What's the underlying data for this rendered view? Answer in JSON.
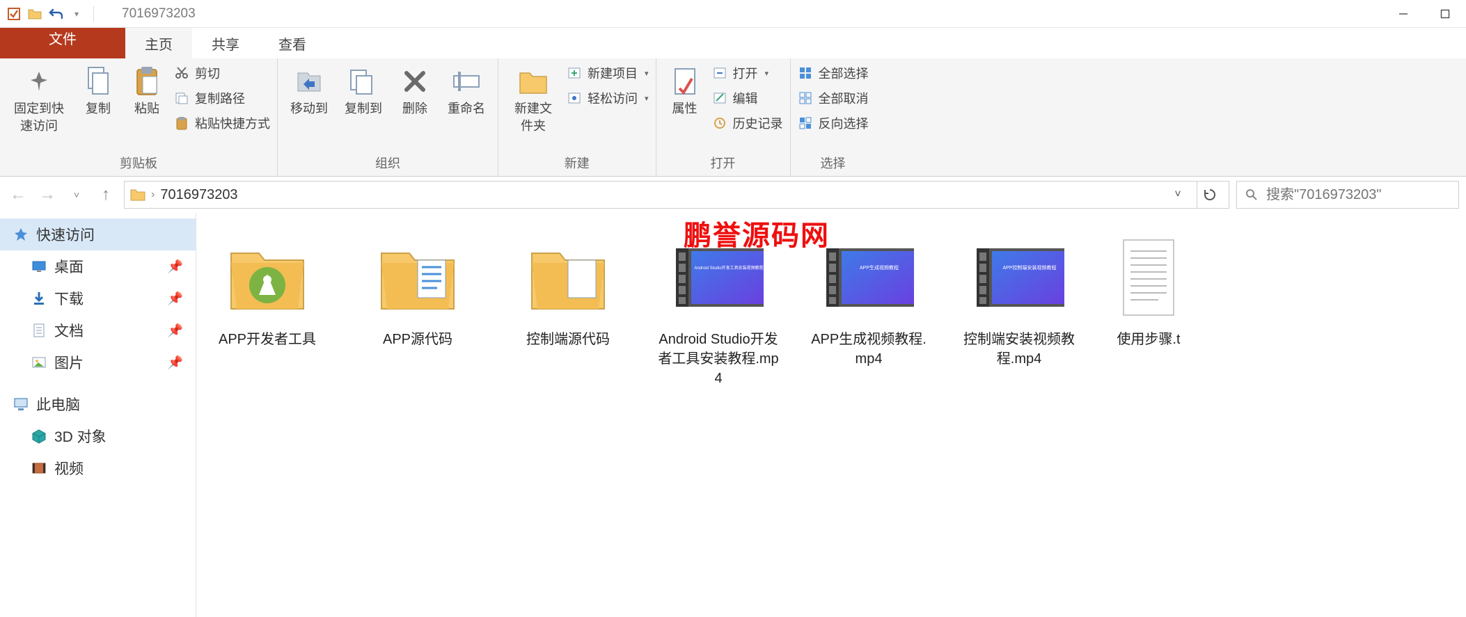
{
  "window": {
    "title": "7016973203",
    "watermark": "鹏誉源码网"
  },
  "tabs": {
    "file": "文件",
    "home": "主页",
    "share": "共享",
    "view": "查看"
  },
  "ribbon": {
    "clipboard": {
      "label": "剪贴板",
      "pin": "固定到快速访问",
      "copy": "复制",
      "paste": "粘贴",
      "cut": "剪切",
      "copy_path": "复制路径",
      "paste_shortcut": "粘贴快捷方式"
    },
    "organize": {
      "label": "组织",
      "move_to": "移动到",
      "copy_to": "复制到",
      "delete": "删除",
      "rename": "重命名"
    },
    "new": {
      "label": "新建",
      "new_folder": "新建文件夹",
      "new_item": "新建项目",
      "easy_access": "轻松访问"
    },
    "open": {
      "label": "打开",
      "properties": "属性",
      "open": "打开",
      "edit": "编辑",
      "history": "历史记录"
    },
    "select": {
      "label": "选择",
      "select_all": "全部选择",
      "select_none": "全部取消",
      "invert": "反向选择"
    }
  },
  "address": {
    "crumb": "7016973203",
    "dropdown_hint": "▾",
    "search_placeholder": "搜索\"7016973203\""
  },
  "sidebar": {
    "quick_access": "快速访问",
    "desktop": "桌面",
    "downloads": "下载",
    "documents": "文档",
    "pictures": "图片",
    "this_pc": "此电脑",
    "objects_3d": "3D 对象",
    "videos": "视频"
  },
  "files": [
    {
      "name": "APP开发者工具",
      "type": "folder_app"
    },
    {
      "name": "APP源代码",
      "type": "folder_docs"
    },
    {
      "name": "控制端源代码",
      "type": "folder_docs"
    },
    {
      "name": "Android Studio开发者工具安装教程.mp4",
      "type": "video"
    },
    {
      "name": "APP生成视频教程.mp4",
      "type": "video"
    },
    {
      "name": "控制端安装视频教程.mp4",
      "type": "video"
    },
    {
      "name": "使用步骤.txt",
      "type": "text",
      "display_name": "使用步骤.t"
    }
  ]
}
